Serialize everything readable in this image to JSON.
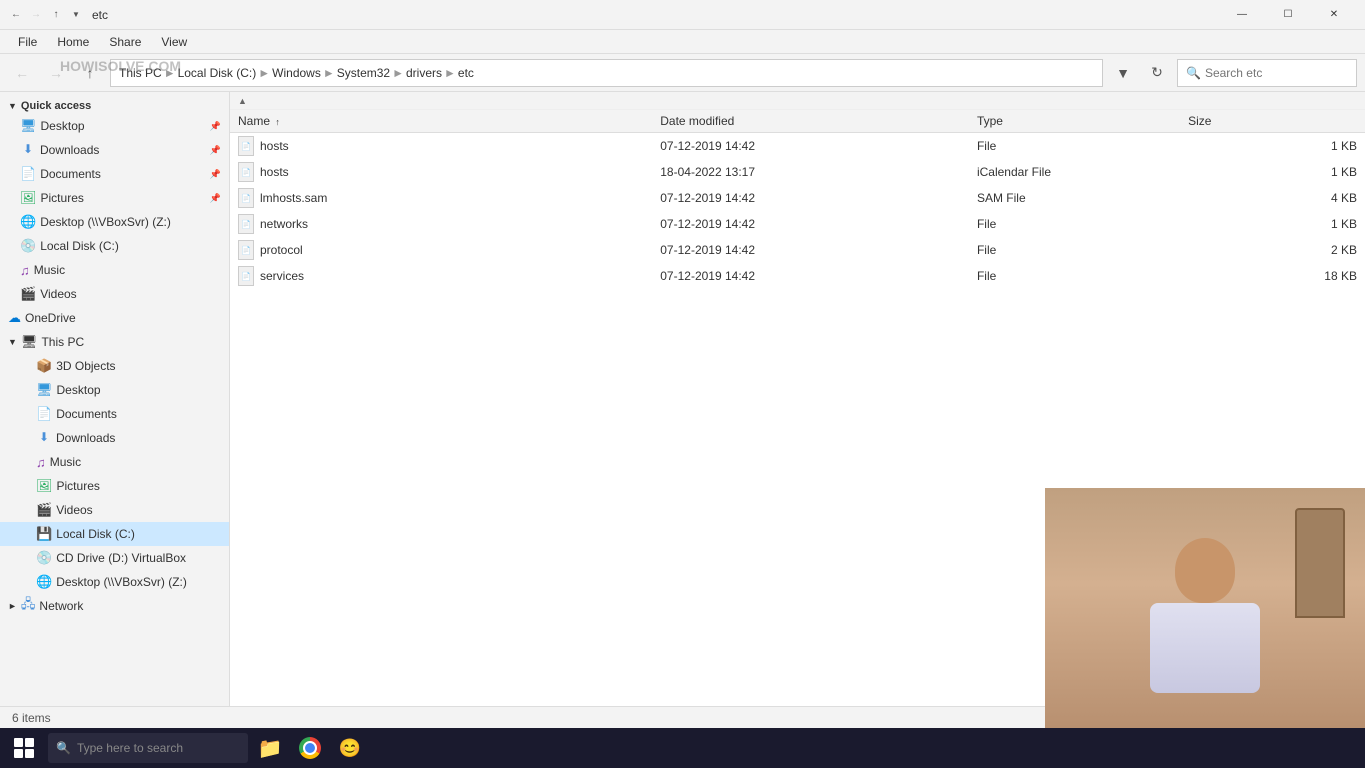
{
  "titleBar": {
    "title": "etc",
    "icons": [
      "back",
      "forward",
      "up"
    ],
    "controls": [
      "minimize",
      "maximize",
      "close"
    ]
  },
  "menuBar": {
    "items": [
      "File",
      "Home",
      "Share",
      "View"
    ]
  },
  "addressBar": {
    "pathParts": [
      "This PC",
      "Local Disk (C:)",
      "Windows",
      "System32",
      "drivers",
      "etc"
    ],
    "searchPlaceholder": "Search etc",
    "refreshBtn": "⟳"
  },
  "watermark": "HOWISOLVE.COM",
  "sidebar": {
    "quickAccess": {
      "label": "Quick access",
      "items": [
        {
          "label": "Desktop",
          "icon": "desktop",
          "pinned": true
        },
        {
          "label": "Downloads",
          "icon": "download",
          "pinned": true
        },
        {
          "label": "Documents",
          "icon": "doc",
          "pinned": true
        },
        {
          "label": "Pictures",
          "icon": "pic",
          "pinned": true
        },
        {
          "label": "Desktop (\\\\VBoxSvr) (Z:)",
          "icon": "network"
        },
        {
          "label": "Local Disk (C:)",
          "icon": "drive"
        },
        {
          "label": "Music",
          "icon": "music"
        },
        {
          "label": "Videos",
          "icon": "video"
        }
      ]
    },
    "oneDrive": {
      "label": "OneDrive",
      "icon": "onedrive"
    },
    "thisPC": {
      "label": "This PC",
      "icon": "thispc",
      "items": [
        {
          "label": "3D Objects",
          "icon": "3d"
        },
        {
          "label": "Desktop",
          "icon": "desktop"
        },
        {
          "label": "Documents",
          "icon": "doc"
        },
        {
          "label": "Downloads",
          "icon": "download"
        },
        {
          "label": "Music",
          "icon": "music"
        },
        {
          "label": "Pictures",
          "icon": "pic"
        },
        {
          "label": "Videos",
          "icon": "video"
        },
        {
          "label": "Local Disk (C:)",
          "icon": "drive",
          "selected": true
        },
        {
          "label": "CD Drive (D:) VirtualBox",
          "icon": "cdrom"
        },
        {
          "label": "Desktop (\\\\VBoxSvr) (Z:)",
          "icon": "network"
        }
      ]
    },
    "network": {
      "label": "Network",
      "icon": "network"
    }
  },
  "fileList": {
    "columns": [
      {
        "label": "Name",
        "sortArrow": "↑"
      },
      {
        "label": "Date modified"
      },
      {
        "label": "Type"
      },
      {
        "label": "Size"
      }
    ],
    "files": [
      {
        "name": "hosts",
        "dateModified": "07-12-2019 14:42",
        "type": "File",
        "size": "1 KB"
      },
      {
        "name": "hosts",
        "dateModified": "18-04-2022 13:17",
        "type": "iCalendar File",
        "size": "1 KB"
      },
      {
        "name": "lmhosts.sam",
        "dateModified": "07-12-2019 14:42",
        "type": "SAM File",
        "size": "4 KB"
      },
      {
        "name": "networks",
        "dateModified": "07-12-2019 14:42",
        "type": "File",
        "size": "1 KB"
      },
      {
        "name": "protocol",
        "dateModified": "07-12-2019 14:42",
        "type": "File",
        "size": "2 KB"
      },
      {
        "name": "services",
        "dateModified": "07-12-2019 14:42",
        "type": "File",
        "size": "18 KB"
      }
    ]
  },
  "statusBar": {
    "itemCount": "6 items"
  },
  "taskbar": {
    "searchPlaceholder": "Type here to search",
    "icons": [
      "file-explorer",
      "chrome",
      "emoji"
    ]
  }
}
